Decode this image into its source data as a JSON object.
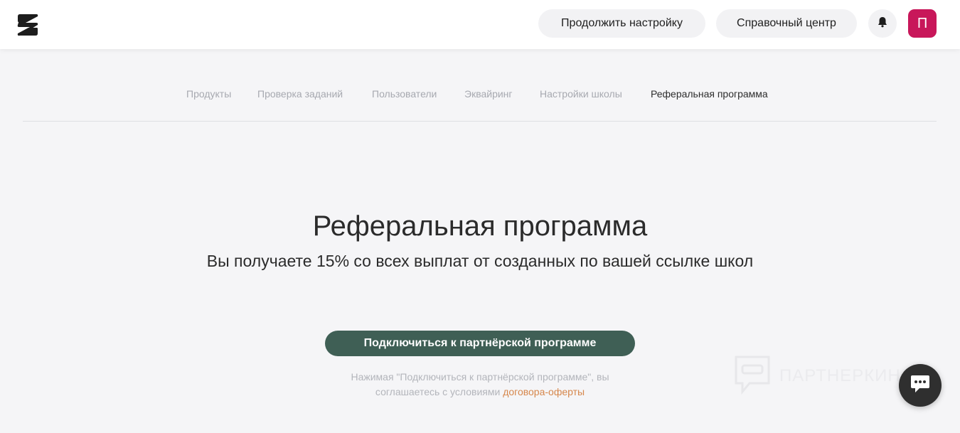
{
  "header": {
    "logo_icon": "brand-logo-icon",
    "continue_label": "Продолжить настройку",
    "help_label": "Справочный центр",
    "bell_icon": "bell-icon",
    "avatar_letter": "П",
    "avatar_color": "#c8175a"
  },
  "tabs": [
    {
      "label": "Продукты",
      "active": false
    },
    {
      "label": "Проверка заданий",
      "active": false
    },
    {
      "label": "Пользователи",
      "active": false
    },
    {
      "label": "Эквайринг",
      "active": false
    },
    {
      "label": "Настройки школы",
      "active": false
    },
    {
      "label": "Реферальная программа",
      "active": true
    }
  ],
  "hero": {
    "title": "Реферальная программа",
    "subtitle": "Вы получаете 15% со всех выплат от созданных по вашей ссылке школ",
    "cta_label": "Подключиться к партнёрской программе",
    "cta_color": "#3f5f55",
    "terms_line1": "Нажимая \"Подключиться к партнёрской программе\", вы",
    "terms_line2_prefix": "соглашаетесь с условиями",
    "terms_link": "договора-оферты",
    "link_color": "#d6874c"
  },
  "watermark": {
    "text": "ПАРТНЕРКИН",
    "icon": "partnerkin-mask-icon"
  },
  "chat": {
    "icon": "chat-bubble-icon"
  }
}
